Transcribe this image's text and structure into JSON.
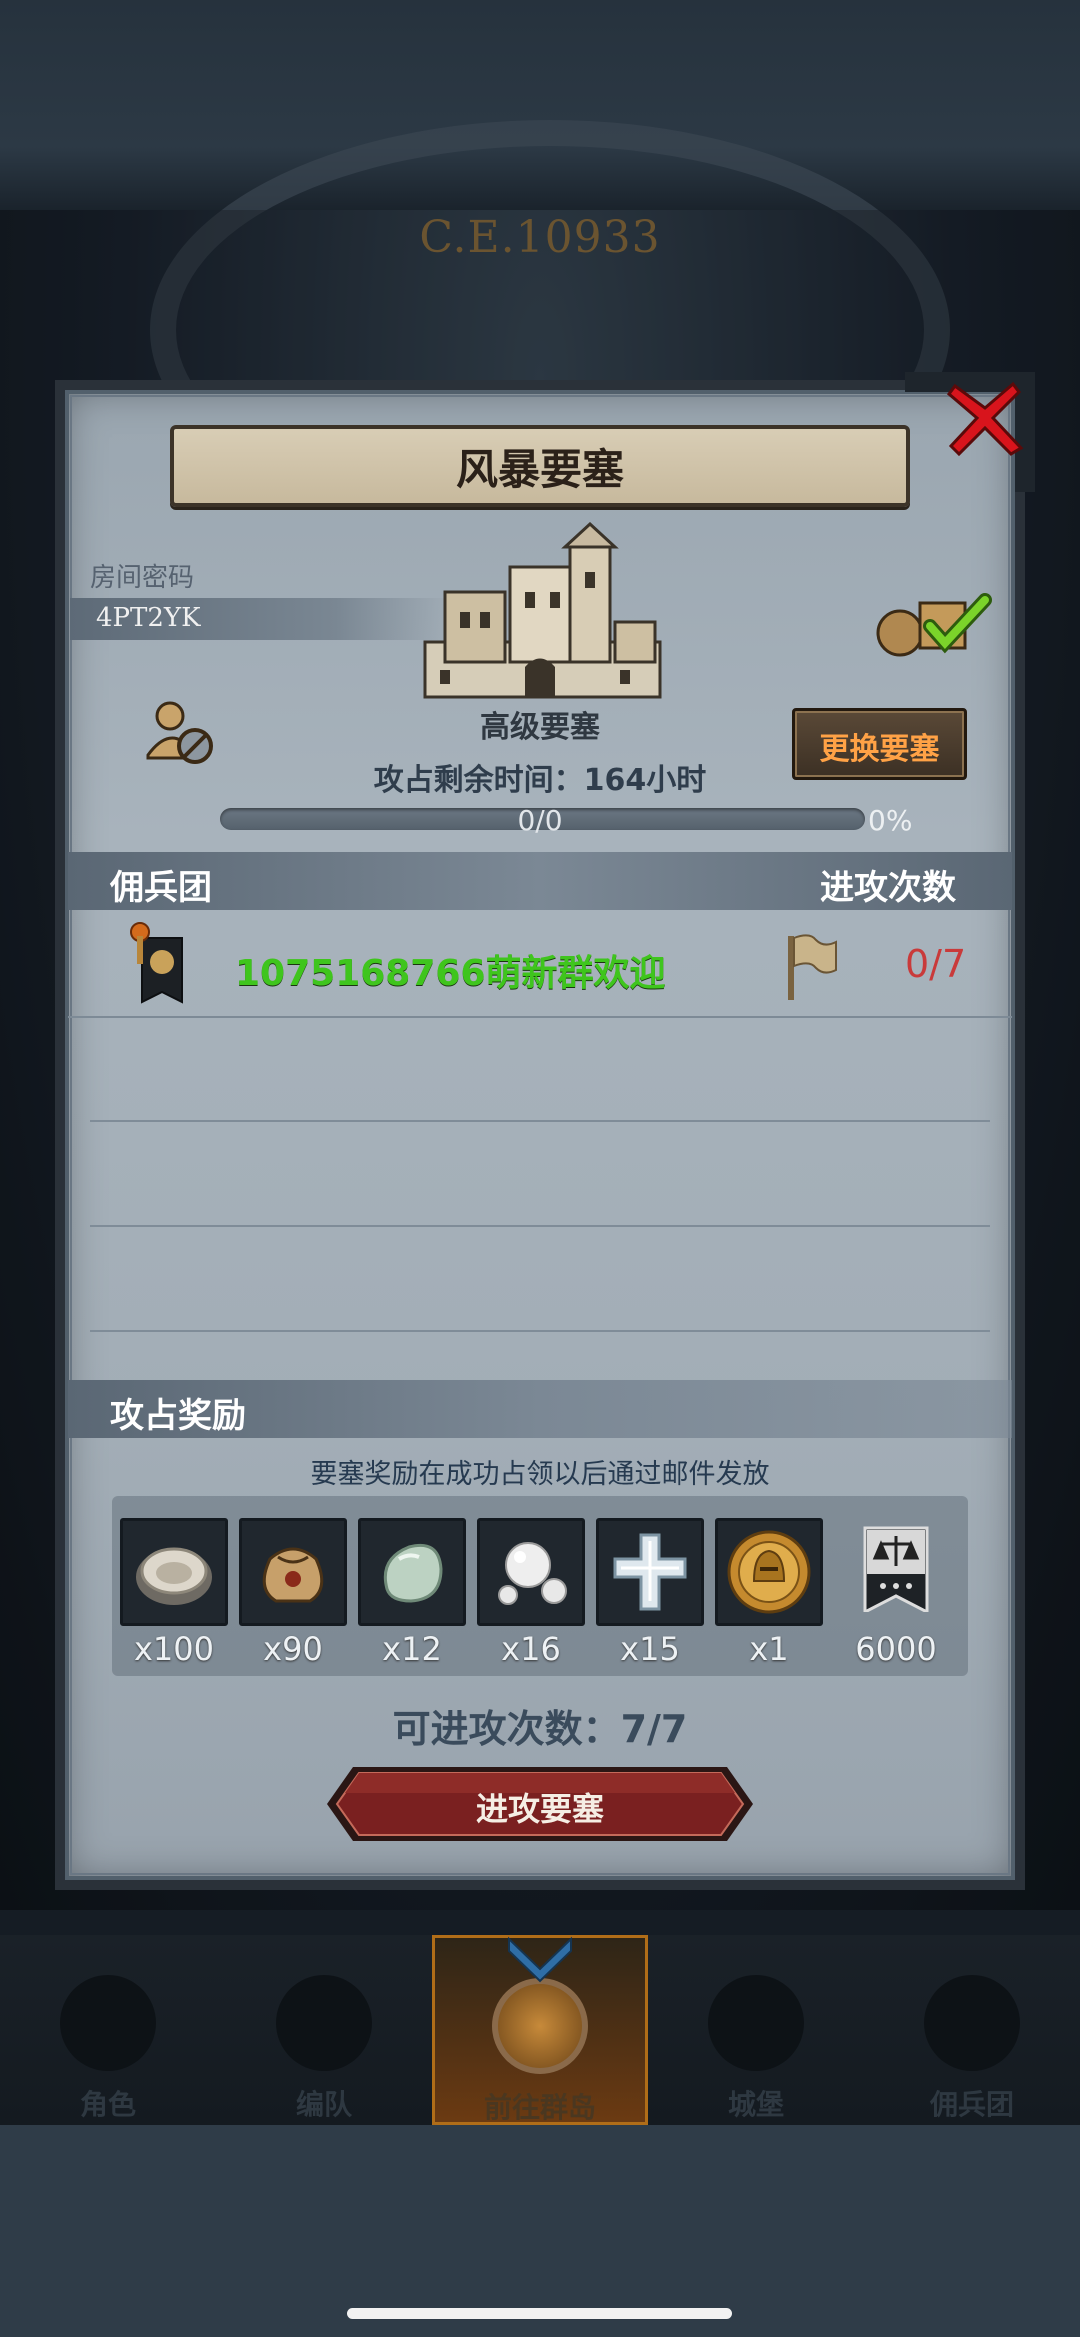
{
  "header": {
    "era": "C.E.10933"
  },
  "modal": {
    "title": "风暴要塞",
    "room_code_label": "房间密码",
    "room_code_value": "4PT2YK",
    "fortress_level": "高级要塞",
    "change_fortress_label": "更换要塞",
    "remaining_time": "攻占剩余时间：164小时",
    "progress": {
      "text": "0/0",
      "percent_text": "0%",
      "fraction": 0
    }
  },
  "mercenary": {
    "header_name": "佣兵团",
    "header_attacks": "进攻次数",
    "rows": [
      {
        "name": "1075168766萌新群欢迎",
        "attacks": "0/7"
      }
    ]
  },
  "rewards": {
    "title": "攻占奖励",
    "note": "要塞奖励在成功占领以后通过邮件发放",
    "items": [
      {
        "icon": "oyster-icon",
        "qty": "x100"
      },
      {
        "icon": "pouch-icon",
        "qty": "x90"
      },
      {
        "icon": "jade-stone-icon",
        "qty": "x12"
      },
      {
        "icon": "pearls-icon",
        "qty": "x16"
      },
      {
        "icon": "crystal-cross-icon",
        "qty": "x15"
      },
      {
        "icon": "golden-helmet-medal-icon",
        "qty": "x1"
      },
      {
        "icon": "justice-banner-icon",
        "qty": "6000"
      }
    ]
  },
  "attack": {
    "remaining": "可进攻次数：7/7",
    "button_label": "进攻要塞"
  },
  "bottom_nav": [
    {
      "label": "角色",
      "icon": "character-icon"
    },
    {
      "label": "编队",
      "icon": "formation-icon"
    },
    {
      "label": "前往群岛",
      "icon": "islands-icon",
      "active": true
    },
    {
      "label": "城堡",
      "icon": "castle-icon"
    },
    {
      "label": "佣兵团",
      "icon": "mercenary-icon"
    }
  ],
  "colors": {
    "accent_orange": "#ffa246",
    "mercenary_green": "#3fc51d",
    "attack_count_red": "#c93a3a",
    "attack_button": "#7a2020"
  }
}
